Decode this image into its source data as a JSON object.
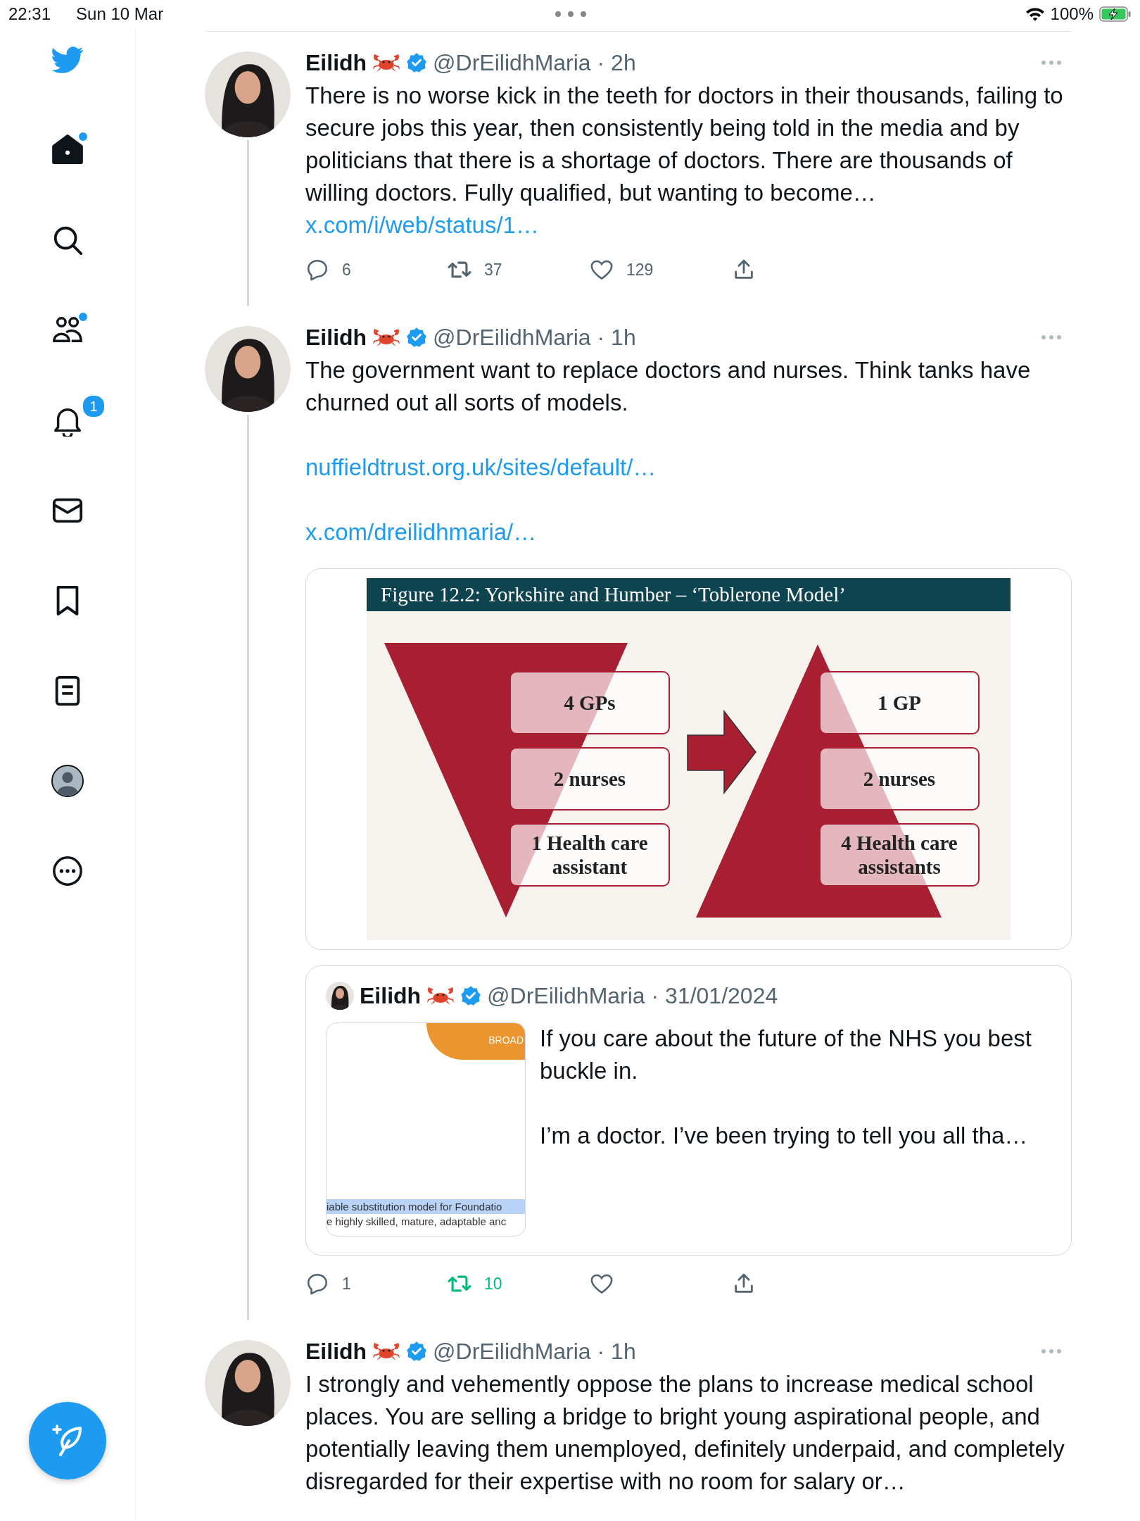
{
  "status_bar": {
    "time": "22:31",
    "date": "Sun 10 Mar",
    "battery": "100%",
    "charging": true
  },
  "sidebar": {
    "items": [
      {
        "kind": "logo"
      },
      {
        "kind": "home",
        "selected": true,
        "dot": true
      },
      {
        "kind": "search",
        "selected": false
      },
      {
        "kind": "communities",
        "selected": false,
        "dot": true
      },
      {
        "kind": "notifications",
        "selected": false,
        "badge": "1"
      },
      {
        "kind": "messages",
        "selected": false
      },
      {
        "kind": "bookmarks",
        "selected": false
      },
      {
        "kind": "lists",
        "selected": false
      },
      {
        "kind": "profile",
        "selected": false
      },
      {
        "kind": "more",
        "selected": false
      }
    ]
  },
  "tweets": [
    {
      "name": "Eilidh",
      "meta": "@DrEilidhMaria · 2h",
      "thread_line": true,
      "text": "There is no worse kick in the teeth for doctors in their thousands, failing to secure jobs this year, then consistently being told in the media and by politicians that there is a shortage of doctors. There are thousands of willing doctors. Fully qualified, but wanting to become…",
      "inline_link": "x.com/i/web/status/1…",
      "actions": {
        "replies": "6",
        "reposts": "37",
        "reposted": false,
        "likes": "129"
      }
    },
    {
      "name": "Eilidh",
      "meta": "@DrEilidhMaria · 1h",
      "thread_line": true,
      "text": "The government want to replace doctors and nurses. Think tanks have churned out all sorts of models.",
      "links": [
        "nuffieldtrust.org.uk/sites/default/…",
        "x.com/dreilidhmaria/…"
      ],
      "figure": {
        "title": "Figure 12.2: Yorkshire and Humber – ‘Toblerone Model’",
        "left_boxes": [
          "4 GPs",
          "2 nurses",
          "1 Health care assistant"
        ],
        "right_boxes": [
          "1 GP",
          "2 nurses",
          "4 Health care assistants"
        ]
      },
      "quote": {
        "name": "Eilidh",
        "meta": "@DrEilidhMaria · 31/01/2024",
        "thumb_tag": "BROAD",
        "thumb_lines": [
          {
            "text": "iable substitution model for Foundatio",
            "selected": true
          },
          {
            "text": "e highly skilled, mature, adaptable anc",
            "selected": false
          }
        ],
        "paragraphs": [
          "If you care about the future of the NHS you best buckle in.",
          "I’m a doctor. I’ve been trying to tell you all tha…"
        ]
      },
      "actions": {
        "replies": "1",
        "reposts": "10",
        "reposted": true
      }
    },
    {
      "name": "Eilidh",
      "meta": "@DrEilidhMaria · 1h",
      "text": "I strongly and vehemently oppose the plans to increase medical school places. You are selling a bridge to bright young aspirational people, and potentially leaving them unemployed, definitely underpaid, and completely disregarded for their expertise with no room for salary or…"
    }
  ]
}
